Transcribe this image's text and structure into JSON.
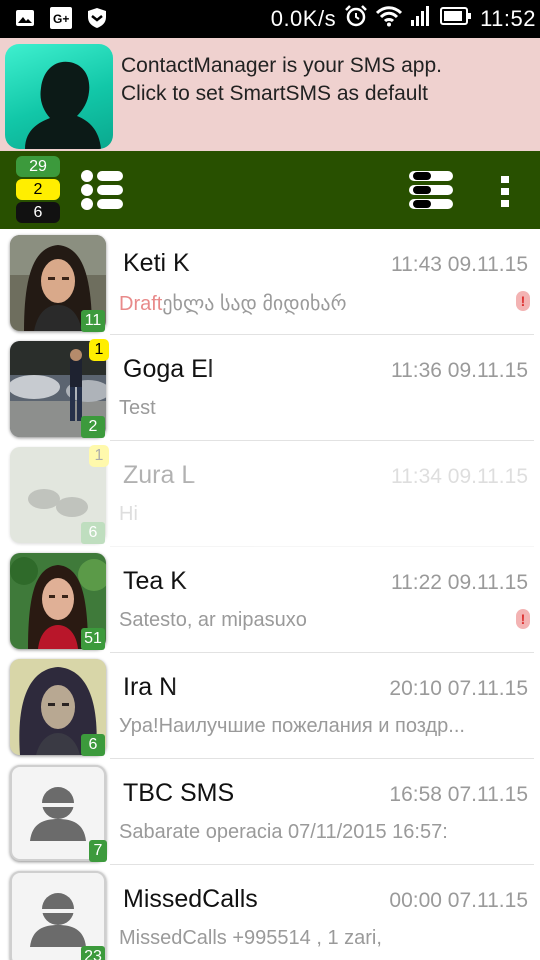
{
  "status_bar": {
    "net_speed": "0.0K/s",
    "time": "11:52",
    "icons": [
      "image-icon",
      "google-plus-icon",
      "shield-icon",
      "alarm-icon",
      "wifi-icon",
      "signal-icon",
      "battery-icon"
    ]
  },
  "banner": {
    "line1": "ContactManager is your SMS app.",
    "line2": "Click to set SmartSMS as default"
  },
  "toolbar": {
    "counters": [
      "29",
      "2",
      "6"
    ],
    "colors": {
      "bg": "#285000",
      "green": "#3c9a3c",
      "yellow": "#ffee00",
      "black": "#111111"
    }
  },
  "conversations": [
    {
      "name": "Keti K",
      "time": "11:43 09.11.15",
      "draft_label": "Draft",
      "snippet": "ეხლა სად მიდიხარ",
      "count": "11",
      "unread": "",
      "alert": "!",
      "avatar": "photo-woman-dark-hair"
    },
    {
      "name": "Goga El",
      "time": "11:36 09.11.15",
      "draft_label": "",
      "snippet": "Test",
      "count": "2",
      "unread": "1",
      "alert": "",
      "avatar": "photo-man-street"
    },
    {
      "name": "Zura L",
      "time": "11:34 09.11.15",
      "draft_label": "",
      "snippet": "Hi",
      "count": "6",
      "unread": "1",
      "alert": "",
      "avatar": "photo-feet"
    },
    {
      "name": "Tea K",
      "time": "11:22 09.11.15",
      "draft_label": "",
      "snippet": "Satesto, ar mipasuxo",
      "count": "51",
      "unread": "",
      "alert": "!",
      "avatar": "photo-woman-garden"
    },
    {
      "name": "Ira N",
      "time": "20:10 07.11.15",
      "draft_label": "",
      "snippet": "Ура!Наилучшие пожелания и поздр...",
      "count": "6",
      "unread": "",
      "alert": "",
      "avatar": "photo-woman-curly"
    },
    {
      "name": "TBC SMS",
      "time": "16:58 07.11.15",
      "draft_label": "",
      "snippet": "Sabarate operacia 07/11/2015 16:57:",
      "count": "7",
      "unread": "",
      "alert": "",
      "avatar": "placeholder"
    },
    {
      "name": "MissedCalls",
      "time": "00:00 07.11.15",
      "draft_label": "",
      "snippet": "MissedCalls  +995514          , 1 zari,",
      "count": "23",
      "unread": "",
      "alert": "",
      "avatar": "placeholder"
    }
  ]
}
